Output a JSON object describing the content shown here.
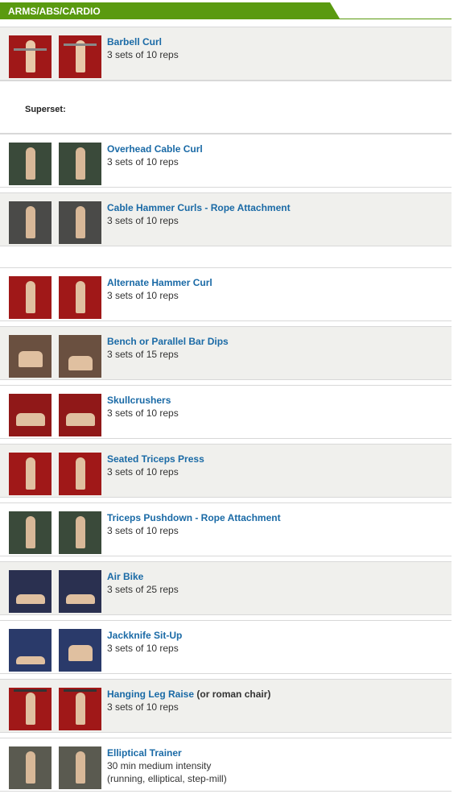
{
  "section": {
    "title": "ARMS/ABS/CARDIO",
    "color": "#5a9a10"
  },
  "superset_label": "Superset:",
  "exercises": [
    {
      "name": "Barbell Curl",
      "detail": "3 sets of 10 reps",
      "note": "",
      "extra": "",
      "bg": "#a01818"
    },
    {
      "name": "Overhead Cable Curl",
      "detail": "3 sets of 10 reps",
      "note": "",
      "extra": "",
      "bg": "#3a4a3a"
    },
    {
      "name": "Cable Hammer Curls - Rope Attachment",
      "detail": "3 sets of 10 reps",
      "note": "",
      "extra": "",
      "bg": "#4a4a48"
    },
    {
      "name": "Alternate Hammer Curl",
      "detail": "3 sets of 10 reps",
      "note": "",
      "extra": "",
      "bg": "#a01818"
    },
    {
      "name": "Bench or Parallel Bar Dips",
      "detail": "3 sets of 15 reps",
      "note": "",
      "extra": "",
      "bg": "#6a5040"
    },
    {
      "name": "Skullcrushers",
      "detail": "3 sets of 10 reps",
      "note": "",
      "extra": "",
      "bg": "#901818"
    },
    {
      "name": "Seated Triceps Press",
      "detail": "3 sets of 10 reps",
      "note": "",
      "extra": "",
      "bg": "#a01818"
    },
    {
      "name": "Triceps Pushdown - Rope Attachment",
      "detail": "3 sets of 10 reps",
      "note": "",
      "extra": "",
      "bg": "#3a4a3a"
    },
    {
      "name": "Air Bike",
      "detail": "3 sets of 25 reps",
      "note": "",
      "extra": "",
      "bg": "#2a3a6a"
    },
    {
      "name": "Jackknife Sit-Up",
      "detail": "3 sets of 10 reps",
      "note": "",
      "extra": "",
      "bg": "#2a3a6a"
    },
    {
      "name": "Hanging Leg Raise",
      "detail": "3 sets of 10 reps",
      "note": " (or roman chair)",
      "extra": "",
      "bg": "#a01818"
    },
    {
      "name": "Elliptical Trainer",
      "detail": "30 min medium intensity",
      "note": "",
      "extra": "(running, elliptical, step-mill)",
      "bg": "#5a5a50"
    }
  ]
}
